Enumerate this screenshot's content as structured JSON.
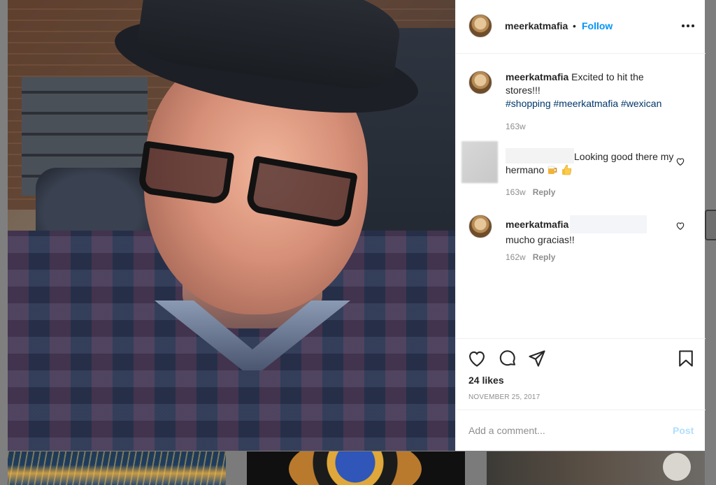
{
  "post": {
    "author": "meerkatmafia",
    "separator": "•",
    "follow_label": "Follow",
    "more_icon": "more-options-icon"
  },
  "caption": {
    "username": "meerkatmafia",
    "text": "Excited to hit the stores!!!",
    "hashtags": [
      "#shopping",
      "#meerkatmafia",
      "#wexican"
    ],
    "time": "163w"
  },
  "comments": [
    {
      "username": "",
      "text": "Looking good there my hermano",
      "emojis": [
        "beer-mug-emoji",
        "thumbs-up-emoji"
      ],
      "time": "163w",
      "reply_label": "Reply"
    },
    {
      "username": "meerkatmafia",
      "text": "mucho gracias!!",
      "time": "162w",
      "reply_label": "Reply"
    }
  ],
  "actions": {
    "likes": "24 likes",
    "date": "NOVEMBER 25, 2017",
    "icons": [
      "heart-icon",
      "comment-icon",
      "share-icon",
      "bookmark-icon"
    ]
  },
  "composer": {
    "placeholder": "Add a comment...",
    "post_label": "Post"
  },
  "colors": {
    "link_blue": "#0095f6",
    "hashtag_blue": "#00376b",
    "muted": "#8e8e8e",
    "disabled_post": "#b2dffc"
  }
}
